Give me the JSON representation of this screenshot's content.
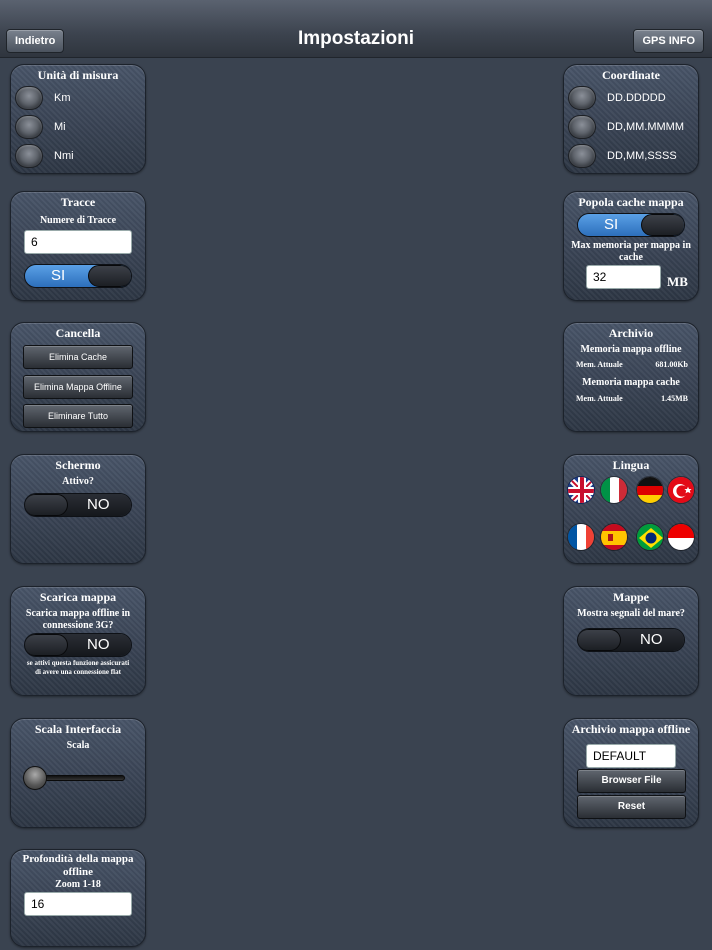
{
  "navbar": {
    "title": "Impostazioni",
    "back_label": "Indietro",
    "gps_label": "GPS INFO"
  },
  "units": {
    "title": "Unità di misura",
    "options": [
      "Km",
      "Mi",
      "Nmi"
    ]
  },
  "coords": {
    "title": "Coordinate",
    "options": [
      "DD.DDDDD",
      "DD,MM.MMMM",
      "DD,MM,SSSS"
    ]
  },
  "tracks": {
    "title": "Tracce",
    "subtitle": "Numere di Tracce",
    "value": "6",
    "toggle_label": "SI",
    "toggle_on": true
  },
  "cache": {
    "title": "Popola cache mappa",
    "toggle_label": "SI",
    "toggle_on": true,
    "subtitle": "Max  memoria per mappa in cache",
    "value": "32",
    "unit": "MB"
  },
  "delete": {
    "title": "Cancella",
    "buttons": [
      "Elimina Cache",
      "Elimina Mappa Offline",
      "Eliminare Tutto"
    ]
  },
  "archive": {
    "title": "Archivio",
    "offline_title": "Memoria mappa offline",
    "offline_label": "Mem. Attuale",
    "offline_value": "681.00Kb",
    "cache_title": "Memoria mappa cache",
    "cache_label": "Mem. Attuale",
    "cache_value": "1.45MB"
  },
  "screen": {
    "title": "Schermo",
    "subtitle": "Attivo?",
    "toggle_label": "NO",
    "toggle_on": false
  },
  "language": {
    "title": "Lingua",
    "flags": [
      "uk-flag-icon",
      "italy-flag-icon",
      "germany-flag-icon",
      "turkey-flag-icon",
      "france-flag-icon",
      "spain-flag-icon",
      "brazil-flag-icon",
      "indonesia-flag-icon"
    ]
  },
  "download": {
    "title": "Scarica mappa",
    "subtitle": "Scarica mappa offline in connessione 3G?",
    "toggle_label": "NO",
    "toggle_on": false,
    "note": "se attivi questa funzione assicurati di avere una connessione flat"
  },
  "maps": {
    "title": "Mappe",
    "subtitle": "Mostra segnali del mare?",
    "toggle_label": "NO",
    "toggle_on": false
  },
  "scale": {
    "title": "Scala Interfaccia",
    "subtitle": "Scala",
    "slider_value": 0
  },
  "offline_archive": {
    "title": "Archivio mappa offline",
    "value": "DEFAULT",
    "browse_label": "Browser File",
    "reset_label": "Reset"
  },
  "depth": {
    "title": "Profondità della mappa offline",
    "subtitle": "Zoom 1-18",
    "value": "16"
  },
  "colors": {
    "toggle_on": "#2d6fbb",
    "panel": "#3a4659",
    "background": "#3a4350"
  }
}
